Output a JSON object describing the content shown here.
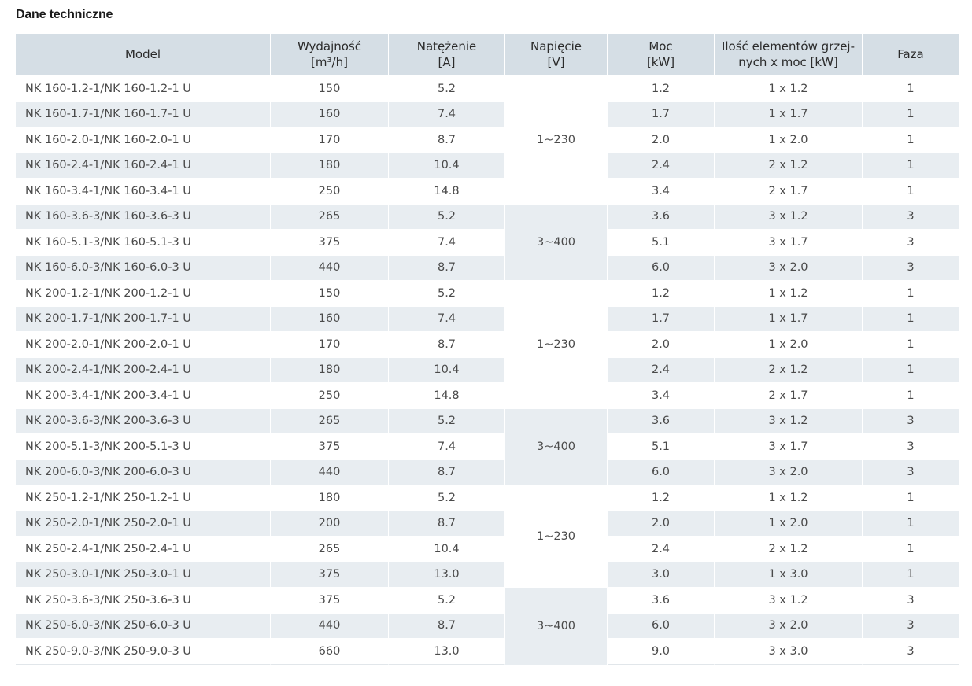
{
  "title": "Dane techniczne",
  "headers": {
    "model": [
      "Model"
    ],
    "flow": [
      "Wydajność",
      "[m³/h]"
    ],
    "current": [
      "Natężenie",
      "[A]"
    ],
    "voltage": [
      "Napięcie",
      "[V]"
    ],
    "power": [
      "Moc",
      "[kW]"
    ],
    "elements": [
      "Ilość elementów grzej-",
      "nych x moc [kW]"
    ],
    "phase": [
      "Faza"
    ]
  },
  "rows": [
    {
      "model": "NK 160-1.2-1/NK 160-1.2-1 U",
      "flow": "150",
      "current": "5.2",
      "power": "1.2",
      "elements": "1 x 1.2",
      "phase": "1"
    },
    {
      "model": "NK 160-1.7-1/NK 160-1.7-1 U",
      "flow": "160",
      "current": "7.4",
      "power": "1.7",
      "elements": "1 x 1.7",
      "phase": "1"
    },
    {
      "model": "NK 160-2.0-1/NK 160-2.0-1 U",
      "flow": "170",
      "current": "8.7",
      "power": "2.0",
      "elements": "1 x 2.0",
      "phase": "1"
    },
    {
      "model": "NK 160-2.4-1/NK 160-2.4-1 U",
      "flow": "180",
      "current": "10.4",
      "power": "2.4",
      "elements": "2 x 1.2",
      "phase": "1"
    },
    {
      "model": "NK 160-3.4-1/NK 160-3.4-1 U",
      "flow": "250",
      "current": "14.8",
      "power": "3.4",
      "elements": "2 x 1.7",
      "phase": "1"
    },
    {
      "model": "NK 160-3.6-3/NK 160-3.6-3 U",
      "flow": "265",
      "current": "5.2",
      "power": "3.6",
      "elements": "3 x 1.2",
      "phase": "3"
    },
    {
      "model": "NK 160-5.1-3/NK 160-5.1-3 U",
      "flow": "375",
      "current": "7.4",
      "power": "5.1",
      "elements": "3 x 1.7",
      "phase": "3"
    },
    {
      "model": "NK 160-6.0-3/NK 160-6.0-3 U",
      "flow": "440",
      "current": "8.7",
      "power": "6.0",
      "elements": "3 x 2.0",
      "phase": "3"
    },
    {
      "model": "NK 200-1.2-1/NK 200-1.2-1 U",
      "flow": "150",
      "current": "5.2",
      "power": "1.2",
      "elements": "1 x 1.2",
      "phase": "1"
    },
    {
      "model": "NK 200-1.7-1/NK 200-1.7-1 U",
      "flow": "160",
      "current": "7.4",
      "power": "1.7",
      "elements": "1 x 1.7",
      "phase": "1"
    },
    {
      "model": "NK 200-2.0-1/NK 200-2.0-1 U",
      "flow": "170",
      "current": "8.7",
      "power": "2.0",
      "elements": "1 x 2.0",
      "phase": "1"
    },
    {
      "model": "NK 200-2.4-1/NK 200-2.4-1 U",
      "flow": "180",
      "current": "10.4",
      "power": "2.4",
      "elements": "2 x 1.2",
      "phase": "1"
    },
    {
      "model": "NK 200-3.4-1/NK 200-3.4-1 U",
      "flow": "250",
      "current": "14.8",
      "power": "3.4",
      "elements": "2 x 1.7",
      "phase": "1"
    },
    {
      "model": "NK 200-3.6-3/NK 200-3.6-3 U",
      "flow": "265",
      "current": "5.2",
      "power": "3.6",
      "elements": "3 x 1.2",
      "phase": "3"
    },
    {
      "model": "NK 200-5.1-3/NK 200-5.1-3 U",
      "flow": "375",
      "current": "7.4",
      "power": "5.1",
      "elements": "3 x 1.7",
      "phase": "3"
    },
    {
      "model": "NK 200-6.0-3/NK 200-6.0-3 U",
      "flow": "440",
      "current": "8.7",
      "power": "6.0",
      "elements": "3 x 2.0",
      "phase": "3"
    },
    {
      "model": "NK 250-1.2-1/NK 250-1.2-1 U",
      "flow": "180",
      "current": "5.2",
      "power": "1.2",
      "elements": "1 x 1.2",
      "phase": "1"
    },
    {
      "model": "NK 250-2.0-1/NK 250-2.0-1 U",
      "flow": "200",
      "current": "8.7",
      "power": "2.0",
      "elements": "1 x 2.0",
      "phase": "1"
    },
    {
      "model": "NK 250-2.4-1/NK 250-2.4-1 U",
      "flow": "265",
      "current": "10.4",
      "power": "2.4",
      "elements": "2 x 1.2",
      "phase": "1"
    },
    {
      "model": "NK 250-3.0-1/NK 250-3.0-1 U",
      "flow": "375",
      "current": "13.0",
      "power": "3.0",
      "elements": "1 x 3.0",
      "phase": "1"
    },
    {
      "model": "NK 250-3.6-3/NK 250-3.6-3 U",
      "flow": "375",
      "current": "5.2",
      "power": "3.6",
      "elements": "3 x 1.2",
      "phase": "3"
    },
    {
      "model": "NK 250-6.0-3/NK 250-6.0-3 U",
      "flow": "440",
      "current": "8.7",
      "power": "6.0",
      "elements": "3 x 2.0",
      "phase": "3"
    },
    {
      "model": "NK 250-9.0-3/NK 250-9.0-3 U",
      "flow": "660",
      "current": "13.0",
      "power": "9.0",
      "elements": "3 x 3.0",
      "phase": "3"
    }
  ],
  "voltage_groups": [
    {
      "start": 0,
      "span": 5,
      "value": "1~230"
    },
    {
      "start": 5,
      "span": 3,
      "value": "3~400"
    },
    {
      "start": 8,
      "span": 5,
      "value": "1~230"
    },
    {
      "start": 13,
      "span": 3,
      "value": "3~400"
    },
    {
      "start": 16,
      "span": 4,
      "value": "1~230"
    },
    {
      "start": 20,
      "span": 3,
      "value": "3~400"
    }
  ],
  "colors": {
    "header_bg": "#d5dee5",
    "stripe_bg": "#e8edf1"
  }
}
